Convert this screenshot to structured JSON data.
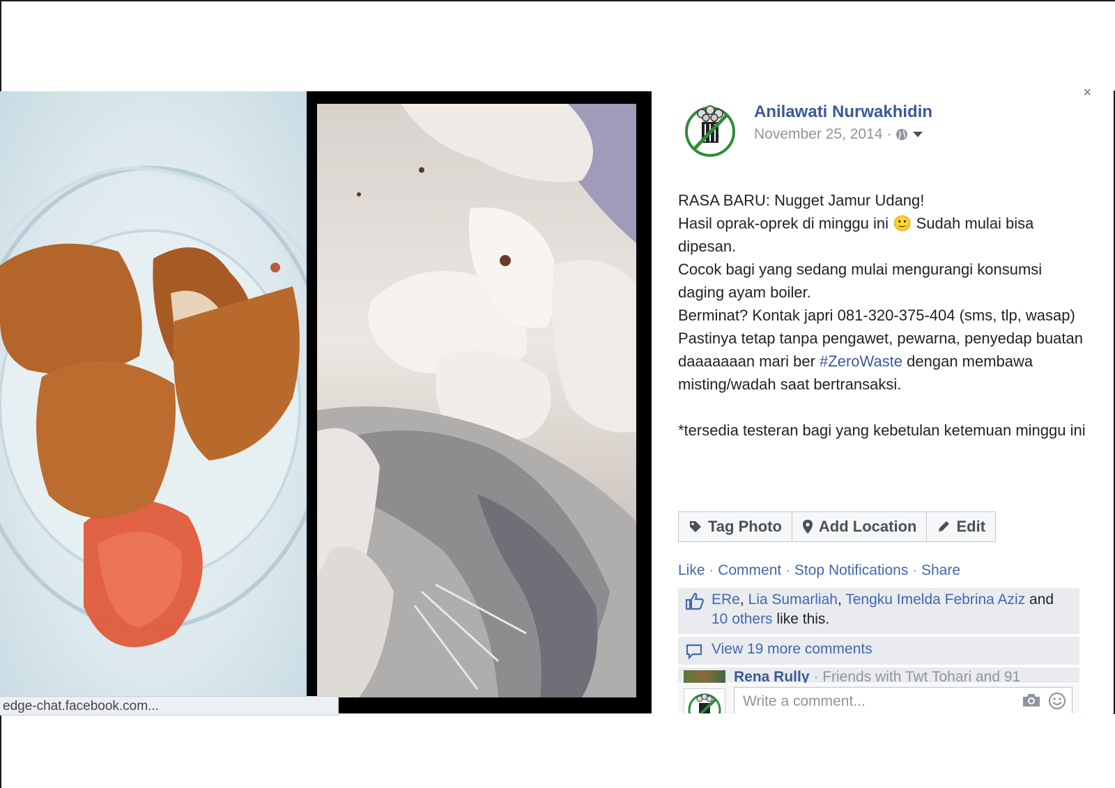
{
  "status_bar": {
    "url": "edge-chat.facebook.com..."
  },
  "post": {
    "author": "Anilawati Nurwakhidin",
    "date": "November 25, 2014",
    "date_sep": "·",
    "lines": [
      "RASA BARU: Nugget Jamur Udang!",
      "Hasil oprak-oprek di minggu ini 🙂 Sudah mulai bisa dipesan.",
      "Cocok bagi yang sedang mulai mengurangi konsumsi daging ayam boiler.",
      "Berminat? Kontak japri 081-320-375-404 (sms, tlp, wasap)",
      "Pastinya tetap tanpa pengawet, pewarna, penyedap buatan daaaaaaan mari ber ",
      "#ZeroWaste",
      " dengan membawa misting/wadah saat bertransaksi.",
      "*tersedia testeran bagi yang kebetulan ketemuan minggu ini"
    ]
  },
  "buttons": {
    "tag": "Tag Photo",
    "location": "Add Location",
    "edit": "Edit"
  },
  "actions": {
    "like": "Like",
    "comment": "Comment",
    "stop": "Stop Notifications",
    "share": "Share",
    "sep": " · "
  },
  "likes": {
    "name1": "ERe",
    "name2": "Lia Sumarliah",
    "name3": "Tengku Imelda Febrina Aziz",
    "and": " and ",
    "others": "10 others",
    "suffix": " like this."
  },
  "more_comments": "View 19 more comments",
  "comment_preview": {
    "name": "Rena Rully",
    "text": " · Friends with Twt Tohari and 91"
  },
  "write_comment": {
    "placeholder": "Write a comment..."
  },
  "icons": {
    "globe": "globe-icon",
    "chevron": "chevron-down-icon",
    "tag": "tag-icon",
    "pin": "location-pin-icon",
    "pencil": "pencil-icon",
    "thumb": "thumbs-up-icon",
    "bubble": "comment-bubble-icon",
    "camera": "camera-icon",
    "smiley": "smiley-icon"
  },
  "colors": {
    "link": "#3b5998",
    "action_link": "#4267b2",
    "meta": "#90949c",
    "panel": "#e9ebee"
  }
}
